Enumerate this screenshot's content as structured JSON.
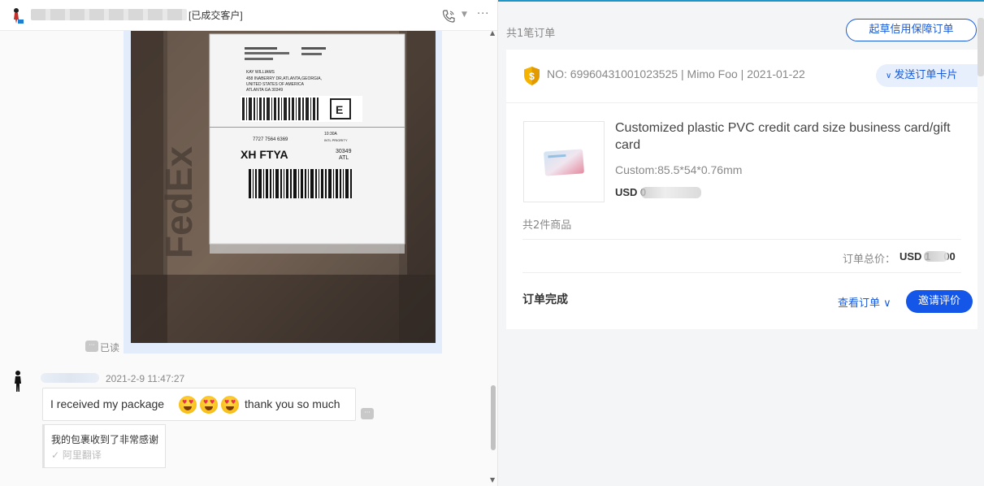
{
  "chat": {
    "header": {
      "customer_tag": "[已成交客户]",
      "more": "···"
    },
    "read_label": "已读",
    "message": {
      "time": "2021-2-9 11:47:27",
      "text_part1": "I received my package",
      "text_part2": "thank you so much",
      "emoji_count": 3,
      "translation": "我的包裹收到了非常感谢",
      "translation_source": "✓ 阿里翻译"
    },
    "photo": {
      "label_name": "KAY WILLIAMS",
      "label_line2": "458 INABERRY DR,ATLANTA,GEORGIA,",
      "label_line3": "UNITED STATES OF AMERICA",
      "label_line4": "ATLANTA GA 30349",
      "tracking": "7727 7564 6369",
      "route": "XH FTYA",
      "zip": "30349",
      "atl": "ATL",
      "service": "10:30A",
      "priority": "INTL PRIORITY",
      "brand": "FedEx"
    }
  },
  "order_panel": {
    "order_count": "共1笔订单",
    "draft_button": "起草信用保障订单",
    "order_meta": "NO: 69960431001023525 | Mimo Foo | 2021-01-22",
    "send_card_button": "发送订单卡片",
    "product": {
      "title": "Customized plastic PVC credit card size business card/gift card",
      "spec": "Custom:85.5*54*0.76mm",
      "price_prefix": "USD",
      "price_visible": "USD 0"
    },
    "items_count": "共2件商品",
    "total_label": "订单总价：",
    "total_prefix": "USD 1",
    "total_suffix": "00",
    "status": "订单完成",
    "view_order": "查看订单",
    "invite_review": "邀请评价"
  },
  "colors": {
    "accent": "#1a5ad8",
    "primary_button": "#1456e8",
    "image_bubble": "#e3ecfb"
  }
}
